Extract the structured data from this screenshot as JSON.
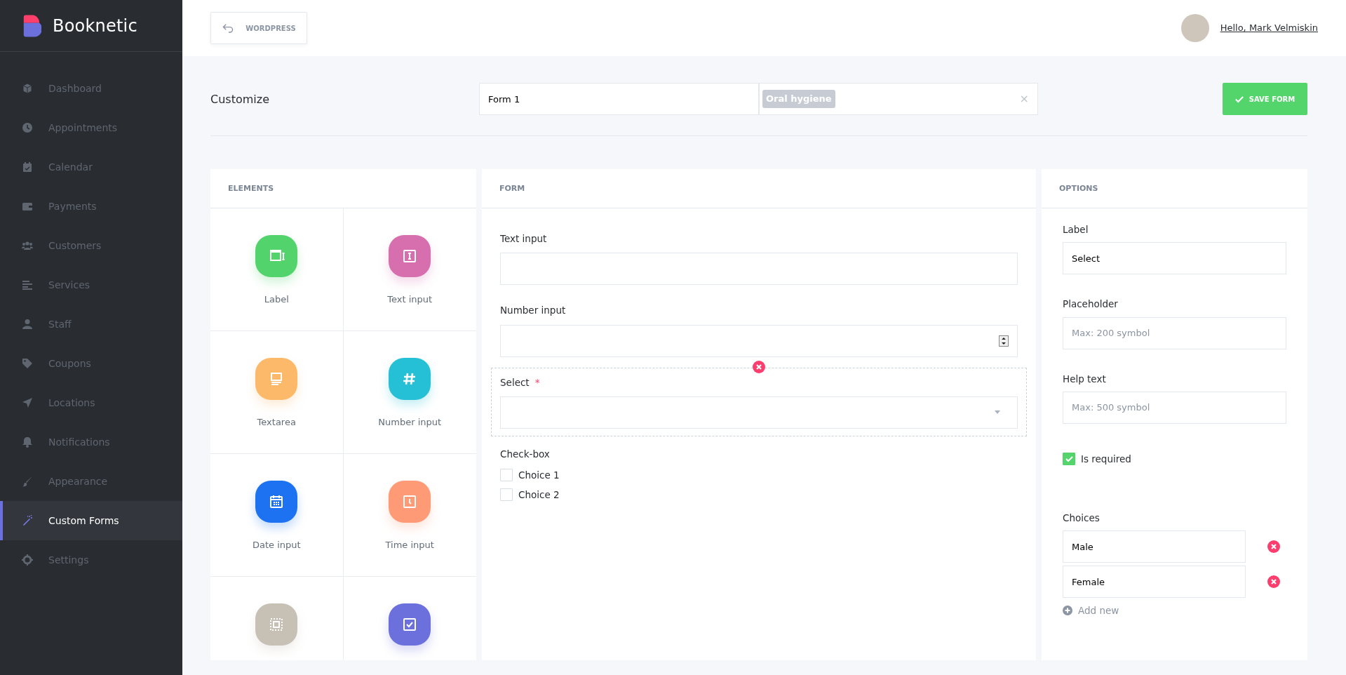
{
  "sidebar": {
    "brand": "Booknetic",
    "items": [
      {
        "label": "Dashboard",
        "selected": false
      },
      {
        "label": "Appointments",
        "selected": false
      },
      {
        "label": "Calendar",
        "selected": false
      },
      {
        "label": "Payments",
        "selected": false
      },
      {
        "label": "Customers",
        "selected": false
      },
      {
        "label": "Services",
        "selected": false
      },
      {
        "label": "Staff",
        "selected": false
      },
      {
        "label": "Coupons",
        "selected": false
      },
      {
        "label": "Locations",
        "selected": false
      },
      {
        "label": "Notifications",
        "selected": false
      },
      {
        "label": "Appearance",
        "selected": false
      },
      {
        "label": "Custom Forms",
        "selected": true
      },
      {
        "label": "Settings",
        "selected": false
      }
    ]
  },
  "header": {
    "back_button": "WORDPRESS",
    "user_greeting": "Hello, Mark Velmiskin"
  },
  "toolbar": {
    "title": "Customize",
    "form_name": "Form 1",
    "services": [
      "Oral hygiene"
    ],
    "clear": "×",
    "save_button": "SAVE FORM"
  },
  "elements": {
    "title": "ELEMENTS",
    "items": [
      {
        "kind": "label",
        "label": "Label",
        "color": "#52d36c"
      },
      {
        "kind": "text",
        "label": "Text input",
        "color": "#d76fae"
      },
      {
        "kind": "textarea",
        "label": "Textarea",
        "color": "#fdb96a"
      },
      {
        "kind": "number",
        "label": "Number input",
        "color": "#25c0d6"
      },
      {
        "kind": "date",
        "label": "Date input",
        "color": "#1d72f2"
      },
      {
        "kind": "time",
        "label": "Time input",
        "color": "#fe9a76"
      },
      {
        "kind": "file",
        "color": "#c7c0b5"
      },
      {
        "kind": "checkbox",
        "color": "#6c70dc"
      }
    ]
  },
  "form": {
    "title": "FORM",
    "required_mark": "*",
    "fields": [
      {
        "kind": "text",
        "label": "Text input",
        "selected": false,
        "required": false
      },
      {
        "kind": "number",
        "label": "Number input",
        "selected": false,
        "required": false
      },
      {
        "kind": "select",
        "label": "Select",
        "selected": true,
        "required": true
      },
      {
        "kind": "checkbox",
        "label": "Check-box",
        "selected": false,
        "required": false,
        "choices": [
          {
            "label": "Choice 1",
            "checked": false
          },
          {
            "label": "Choice 2",
            "checked": false
          }
        ]
      }
    ]
  },
  "options": {
    "title": "OPTIONS",
    "label_field": {
      "label": "Label",
      "value": "Select"
    },
    "placeholder_field": {
      "label": "Placeholder",
      "placeholder": "Max: 200 symbol"
    },
    "help_field": {
      "label": "Help text",
      "placeholder": "Max: 500 symbol"
    },
    "required": {
      "label": "Is required",
      "checked": true
    },
    "choices": {
      "label": "Choices",
      "items": [
        "Male",
        "Female"
      ],
      "add_new": "Add new"
    }
  }
}
